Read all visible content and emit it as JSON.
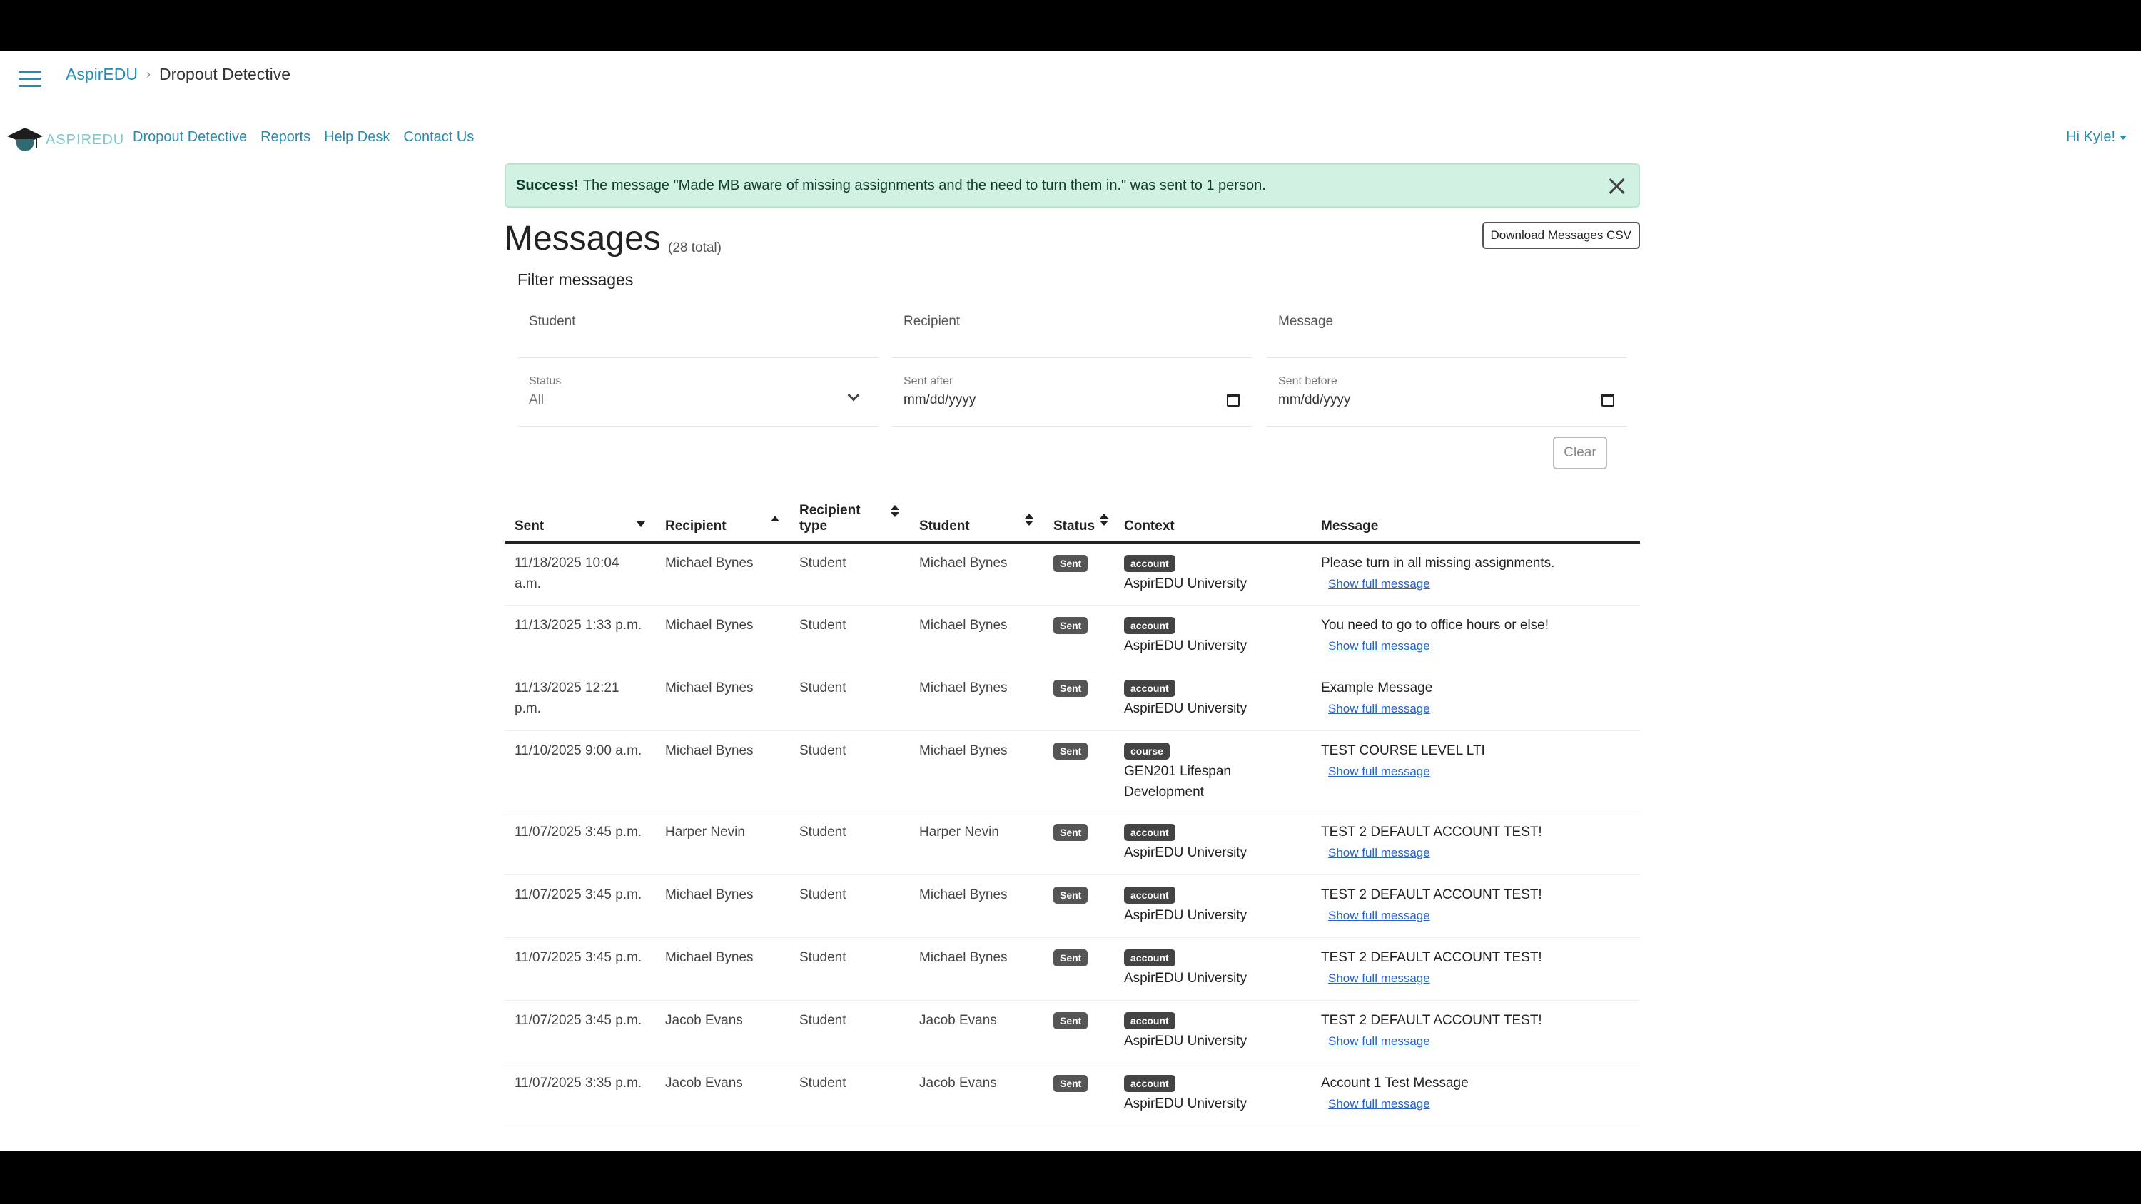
{
  "breadcrumb": {
    "root": "AspirEDU",
    "current": "Dropout Detective"
  },
  "brand": {
    "logo_text": "ASPIREDU"
  },
  "nav": {
    "links": [
      "Dropout Detective",
      "Reports",
      "Help Desk",
      "Contact Us"
    ],
    "user": "Hi Kyle!"
  },
  "alert": {
    "strong": "Success!",
    "text": "The message \"Made MB aware of missing assignments and the need to turn them in.\" was sent to 1 person."
  },
  "page": {
    "title": "Messages",
    "total": "(28 total)",
    "csv_button": "Download Messages CSV"
  },
  "filter": {
    "heading": "Filter messages",
    "student_label": "Student",
    "recipient_label": "Recipient",
    "message_label": "Message",
    "status_label": "Status",
    "status_value": "All",
    "sent_after_label": "Sent after",
    "sent_after_value": "mm/dd/yyyy",
    "sent_before_label": "Sent before",
    "sent_before_value": "mm/dd/yyyy",
    "clear_button": "Clear"
  },
  "table": {
    "headers": [
      "Sent",
      "Recipient",
      "Recipient type",
      "Student",
      "Status",
      "Context",
      "Message"
    ],
    "show_full": "Show full message",
    "rows": [
      {
        "sent": "11/18/2025 10:04 a.m.",
        "recipient": "Michael Bynes",
        "type": "Student",
        "student": "Michael Bynes",
        "status": "Sent",
        "context_badge": "account",
        "context": "AspirEDU University",
        "message": "Please turn in all missing assignments."
      },
      {
        "sent": "11/13/2025 1:33 p.m.",
        "recipient": "Michael Bynes",
        "type": "Student",
        "student": "Michael Bynes",
        "status": "Sent",
        "context_badge": "account",
        "context": "AspirEDU University",
        "message": "You need to go to office hours or else!"
      },
      {
        "sent": "11/13/2025 12:21 p.m.",
        "recipient": "Michael Bynes",
        "type": "Student",
        "student": "Michael Bynes",
        "status": "Sent",
        "context_badge": "account",
        "context": "AspirEDU University",
        "message": "Example Message"
      },
      {
        "sent": "11/10/2025 9:00 a.m.",
        "recipient": "Michael Bynes",
        "type": "Student",
        "student": "Michael Bynes",
        "status": "Sent",
        "context_badge": "course",
        "context": "GEN201 Lifespan Development",
        "message": "TEST COURSE LEVEL LTI"
      },
      {
        "sent": "11/07/2025 3:45 p.m.",
        "recipient": "Harper Nevin",
        "type": "Student",
        "student": "Harper Nevin",
        "status": "Sent",
        "context_badge": "account",
        "context": "AspirEDU University",
        "message": "TEST 2 DEFAULT ACCOUNT TEST!"
      },
      {
        "sent": "11/07/2025 3:45 p.m.",
        "recipient": "Michael Bynes",
        "type": "Student",
        "student": "Michael Bynes",
        "status": "Sent",
        "context_badge": "account",
        "context": "AspirEDU University",
        "message": "TEST 2 DEFAULT ACCOUNT TEST!"
      },
      {
        "sent": "11/07/2025 3:45 p.m.",
        "recipient": "Michael Bynes",
        "type": "Student",
        "student": "Michael Bynes",
        "status": "Sent",
        "context_badge": "account",
        "context": "AspirEDU University",
        "message": "TEST 2 DEFAULT ACCOUNT TEST!"
      },
      {
        "sent": "11/07/2025 3:45 p.m.",
        "recipient": "Jacob Evans",
        "type": "Student",
        "student": "Jacob Evans",
        "status": "Sent",
        "context_badge": "account",
        "context": "AspirEDU University",
        "message": "TEST 2 DEFAULT ACCOUNT TEST!"
      },
      {
        "sent": "11/07/2025 3:35 p.m.",
        "recipient": "Jacob Evans",
        "type": "Student",
        "student": "Jacob Evans",
        "status": "Sent",
        "context_badge": "account",
        "context": "AspirEDU University",
        "message": "Account 1 Test Message"
      }
    ]
  }
}
